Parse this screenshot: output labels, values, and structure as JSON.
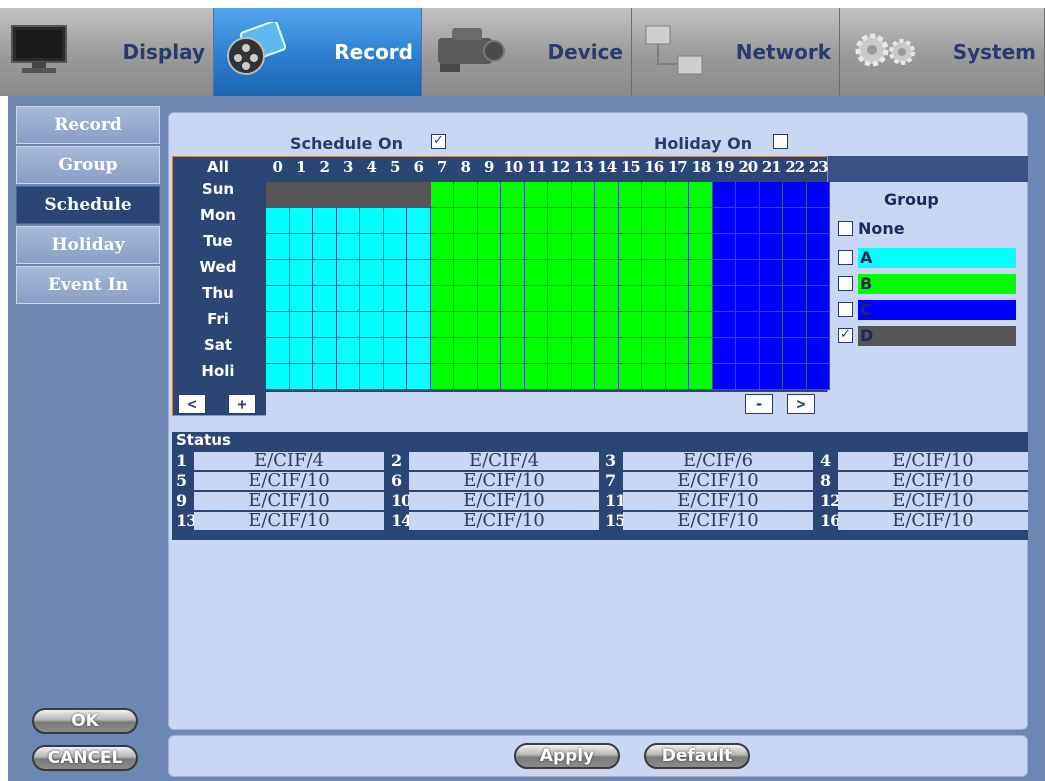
{
  "nav": {
    "tabs": [
      {
        "label": "Display",
        "icon": "monitor-icon"
      },
      {
        "label": "Record",
        "icon": "film-reel-icon",
        "active": true
      },
      {
        "label": "Device",
        "icon": "camcorder-icon"
      },
      {
        "label": "Network",
        "icon": "network-icon"
      },
      {
        "label": "System",
        "icon": "gears-icon"
      }
    ]
  },
  "sidebar": {
    "items": [
      "Record",
      "Group",
      "Schedule",
      "Holiday",
      "Event In"
    ],
    "active": "Schedule"
  },
  "buttons": {
    "ok": "OK",
    "cancel": "CANCEL",
    "apply": "Apply",
    "default": "Default"
  },
  "schedule": {
    "schedule_on_label": "Schedule On",
    "schedule_on_checked": true,
    "holiday_on_label": "Holiday On",
    "holiday_on_checked": false,
    "all_label": "All",
    "hours": [
      "0",
      "1",
      "2",
      "3",
      "4",
      "5",
      "6",
      "7",
      "8",
      "9",
      "10",
      "11",
      "12",
      "13",
      "14",
      "15",
      "16",
      "17",
      "18",
      "19",
      "20",
      "21",
      "22",
      "23"
    ],
    "days": [
      {
        "label": "Sun",
        "hours": "DDDDDDDBBBBBBBBBBBBCCCCC"
      },
      {
        "label": "Mon",
        "hours": "AAAAAAABBBBBBBBBBBBCCCCC"
      },
      {
        "label": "Tue",
        "hours": "AAAAAAABBBBBBBBBBBBCCCCC"
      },
      {
        "label": "Wed",
        "hours": "AAAAAAABBBBBBBBBBBBCCCCC"
      },
      {
        "label": "Thu",
        "hours": "AAAAAAABBBBBBBBBBBBCCCCC"
      },
      {
        "label": "Fri",
        "hours": "AAAAAAABBBBBBBBBBBBCCCCC"
      },
      {
        "label": "Sat",
        "hours": "AAAAAAABBBBBBBBBBBBCCCCC"
      },
      {
        "label": "Holi",
        "hours": "AAAAAAABBBBBBBBBBBBCCCCC"
      }
    ],
    "nav": {
      "prev": "<",
      "zoom_in": "+",
      "zoom_out": "-",
      "next": ">"
    }
  },
  "group": {
    "title": "Group",
    "none_label": "None",
    "none_checked": false,
    "items": [
      {
        "label": "A",
        "color": "#00ffff",
        "checked": false
      },
      {
        "label": "B",
        "color": "#00ff00",
        "checked": false
      },
      {
        "label": "C",
        "color": "#0000ff",
        "checked": false
      },
      {
        "label": "D",
        "color": "#555555",
        "checked": true
      }
    ]
  },
  "status": {
    "title": "Status",
    "channels": [
      {
        "ch": "1",
        "value": "E/CIF/4"
      },
      {
        "ch": "2",
        "value": "E/CIF/4"
      },
      {
        "ch": "3",
        "value": "E/CIF/6"
      },
      {
        "ch": "4",
        "value": "E/CIF/10"
      },
      {
        "ch": "5",
        "value": "E/CIF/10"
      },
      {
        "ch": "6",
        "value": "E/CIF/10"
      },
      {
        "ch": "7",
        "value": "E/CIF/10"
      },
      {
        "ch": "8",
        "value": "E/CIF/10"
      },
      {
        "ch": "9",
        "value": "E/CIF/10"
      },
      {
        "ch": "10",
        "value": "E/CIF/10"
      },
      {
        "ch": "11",
        "value": "E/CIF/10"
      },
      {
        "ch": "12",
        "value": "E/CIF/10"
      },
      {
        "ch": "13",
        "value": "E/CIF/10"
      },
      {
        "ch": "14",
        "value": "E/CIF/10"
      },
      {
        "ch": "15",
        "value": "E/CIF/10"
      },
      {
        "ch": "16",
        "value": "E/CIF/10"
      }
    ]
  },
  "colors": {
    "A": "#00ffff",
    "B": "#00ff00",
    "C": "#0000ff",
    "D": "#555555"
  }
}
